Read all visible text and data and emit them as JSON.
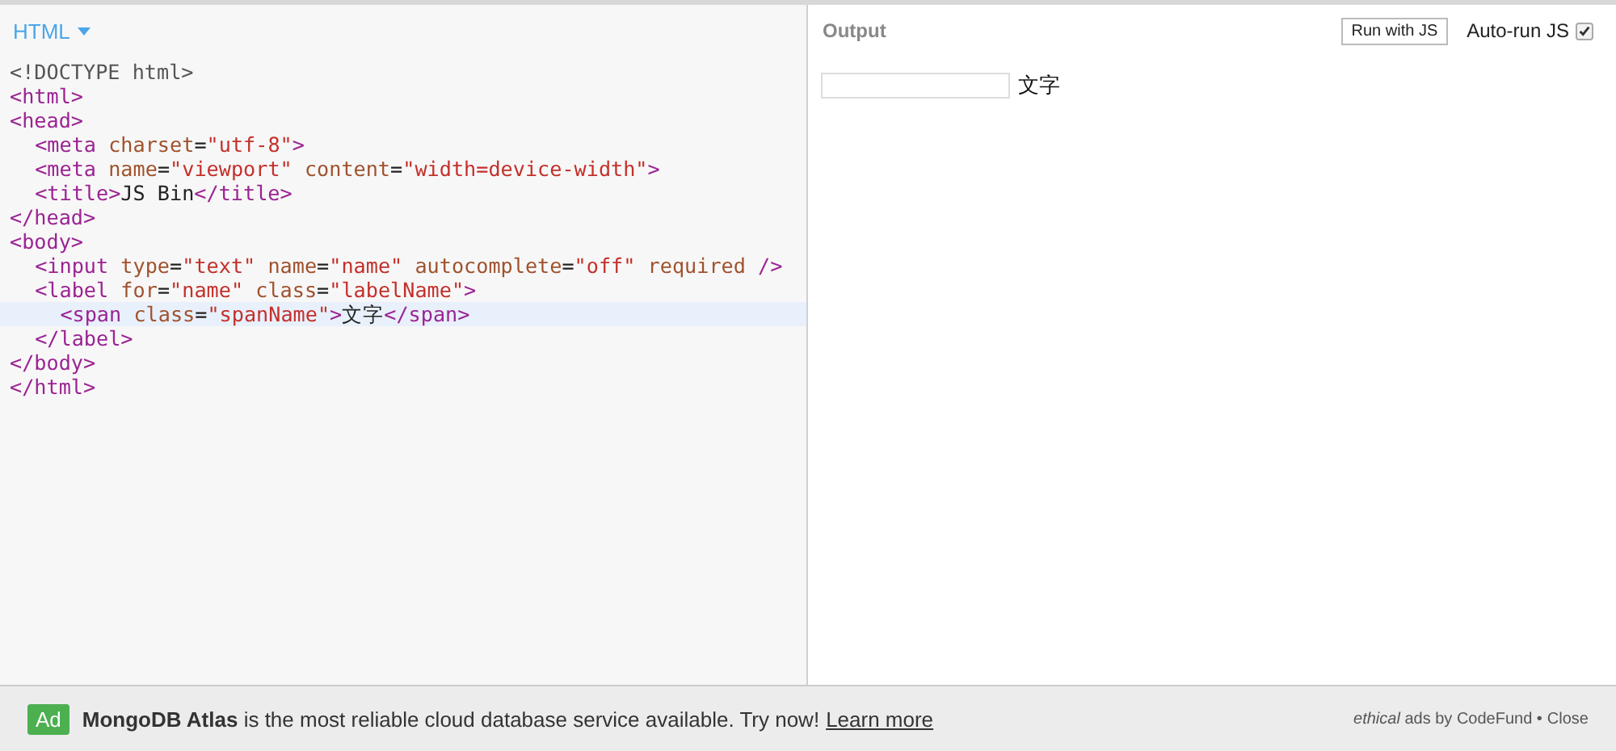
{
  "editor": {
    "panel_label": "HTML",
    "lines": [
      {
        "active": false,
        "tokens": [
          {
            "kind": "meta",
            "text": "<!DOCTYPE html>"
          }
        ]
      },
      {
        "active": false,
        "tokens": [
          {
            "kind": "tag",
            "text": "<html>"
          }
        ]
      },
      {
        "active": false,
        "tokens": [
          {
            "kind": "tag",
            "text": "<head>"
          }
        ],
        "children": [
          {
            "active": false,
            "tokens": [
              {
                "kind": "tag",
                "text": "<meta"
              },
              {
                "kind": "attr",
                "text": " charset"
              },
              {
                "kind": "plain",
                "text": "="
              },
              {
                "kind": "string",
                "text": "\"utf-8\""
              },
              {
                "kind": "tag",
                "text": ">"
              }
            ]
          },
          {
            "active": false,
            "tokens": [
              {
                "kind": "tag",
                "text": "<meta"
              },
              {
                "kind": "attr",
                "text": " name"
              },
              {
                "kind": "plain",
                "text": "="
              },
              {
                "kind": "string",
                "text": "\"viewport\""
              },
              {
                "kind": "attr",
                "text": " content"
              },
              {
                "kind": "plain",
                "text": "="
              },
              {
                "kind": "string",
                "text": "\"width=device-width\""
              },
              {
                "kind": "tag",
                "text": ">"
              }
            ]
          },
          {
            "active": false,
            "tokens": [
              {
                "kind": "tag",
                "text": "<title>"
              },
              {
                "kind": "plain",
                "text": "JS Bin"
              },
              {
                "kind": "tag",
                "text": "</title>"
              }
            ]
          }
        ]
      },
      {
        "active": false,
        "tokens": [
          {
            "kind": "tag",
            "text": "</head>"
          }
        ]
      },
      {
        "active": false,
        "tokens": [
          {
            "kind": "tag",
            "text": "<body>"
          }
        ],
        "children": [
          {
            "active": false,
            "tokens": [
              {
                "kind": "tag",
                "text": "<input"
              },
              {
                "kind": "attr",
                "text": " type"
              },
              {
                "kind": "plain",
                "text": "="
              },
              {
                "kind": "string",
                "text": "\"text\""
              },
              {
                "kind": "attr",
                "text": " name"
              },
              {
                "kind": "plain",
                "text": "="
              },
              {
                "kind": "string",
                "text": "\"name\""
              },
              {
                "kind": "attr",
                "text": " autocomplete"
              },
              {
                "kind": "plain",
                "text": "="
              },
              {
                "kind": "string",
                "text": "\"off\""
              },
              {
                "kind": "attr",
                "text": " required"
              },
              {
                "kind": "tag",
                "text": " />"
              }
            ]
          },
          {
            "active": false,
            "tokens": [
              {
                "kind": "tag",
                "text": "<label"
              },
              {
                "kind": "attr",
                "text": " for"
              },
              {
                "kind": "plain",
                "text": "="
              },
              {
                "kind": "string",
                "text": "\"name\""
              },
              {
                "kind": "attr",
                "text": " class"
              },
              {
                "kind": "plain",
                "text": "="
              },
              {
                "kind": "string",
                "text": "\"labelName\""
              },
              {
                "kind": "tag",
                "text": ">"
              }
            ],
            "children": [
              {
                "active": true,
                "tokens": [
                  {
                    "kind": "tag",
                    "text": "<span"
                  },
                  {
                    "kind": "attr",
                    "text": " class"
                  },
                  {
                    "kind": "plain",
                    "text": "="
                  },
                  {
                    "kind": "string",
                    "text": "\"spanName\""
                  },
                  {
                    "kind": "tag",
                    "text": ">"
                  },
                  {
                    "kind": "plain",
                    "text": "文字"
                  },
                  {
                    "kind": "tag",
                    "text": "</span>"
                  }
                ]
              }
            ]
          },
          {
            "active": false,
            "tokens": [
              {
                "kind": "tag",
                "text": "</label>"
              }
            ]
          }
        ]
      },
      {
        "active": false,
        "tokens": [
          {
            "kind": "tag",
            "text": "</body>"
          }
        ]
      },
      {
        "active": false,
        "tokens": [
          {
            "kind": "tag",
            "text": "</html>"
          }
        ]
      }
    ]
  },
  "output": {
    "panel_label": "Output",
    "run_button": "Run with JS",
    "auto_run": {
      "label": "Auto-run JS",
      "checked": true
    },
    "preview_label": "文字"
  },
  "ad_bar": {
    "badge": "Ad",
    "message": "**MongoDB Atlas** is the most reliable cloud database service available. Try now!",
    "link": "Learn more",
    "credit": "*ethical* ads by CodeFund •",
    "close": "Close"
  }
}
